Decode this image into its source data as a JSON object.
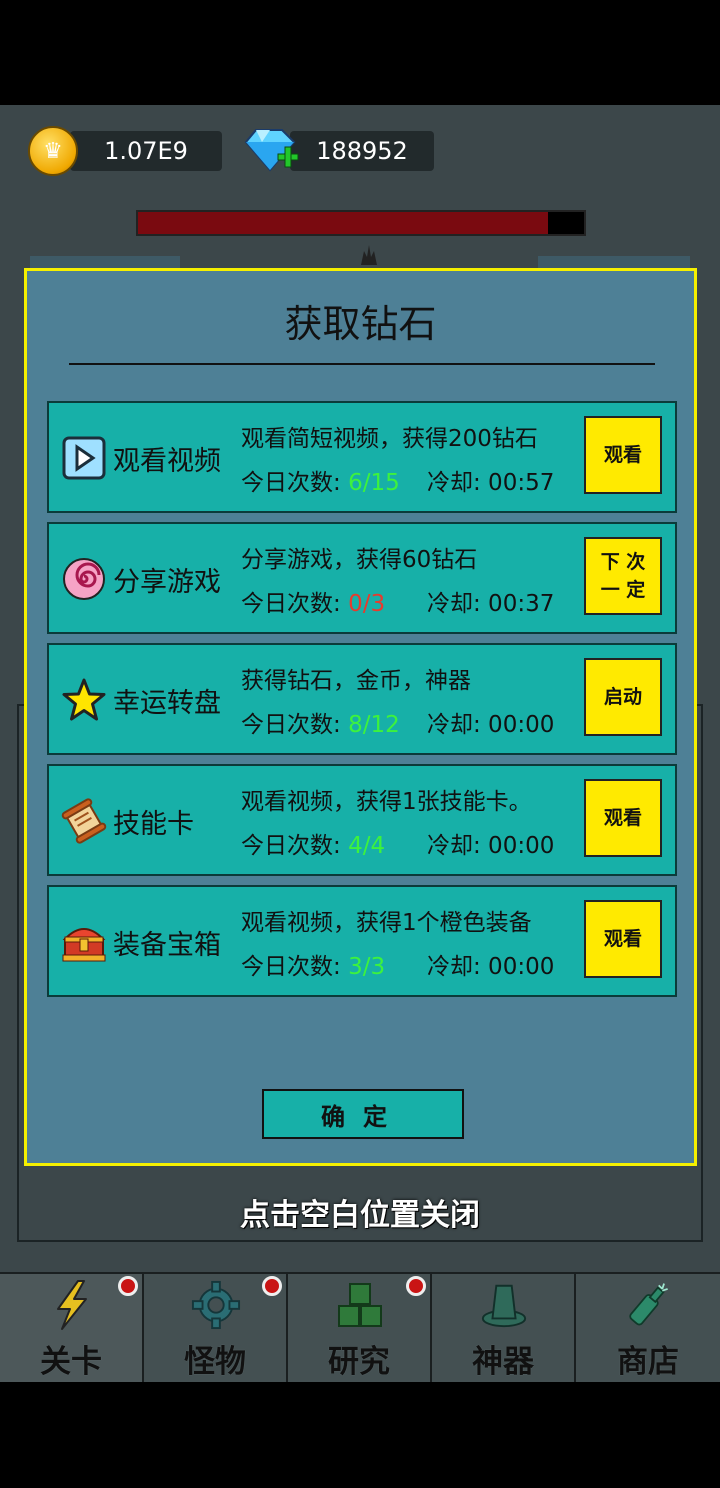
{
  "header": {
    "gold_amount": "1.07E9",
    "diamond_amount": "188952",
    "hp_fraction": 0.92
  },
  "modal": {
    "title": "获取钻石",
    "rows": [
      {
        "name": "观看视频",
        "desc": "观看简短视频，获得200钻石",
        "stat_label": "今日次数: ",
        "count": "6/15",
        "count_color": "#3df23d",
        "cooldown": "冷却: 00:57",
        "button": "观看",
        "icon": "play-icon"
      },
      {
        "name": "分享游戏",
        "desc": "分享游戏，获得60钻石",
        "stat_label": "今日次数: ",
        "count": "0/3",
        "count_color": "#e63b2e",
        "cooldown": "冷却: 00:37",
        "button_line1": "下 次",
        "button_line2": "一 定",
        "icon": "swirl-icon"
      },
      {
        "name": "幸运转盘",
        "desc": "获得钻石，金币，神器",
        "stat_label": "今日次数: ",
        "count": "8/12",
        "count_color": "#3df23d",
        "cooldown": "冷却: 00:00",
        "button": "启动",
        "icon": "star-icon"
      },
      {
        "name": "技能卡",
        "desc": "观看视频，获得1张技能卡。",
        "stat_label": "今日次数: ",
        "count": "4/4",
        "count_color": "#3df23d",
        "cooldown": "冷却: 00:00",
        "button": "观看",
        "icon": "scroll-icon"
      },
      {
        "name": "装备宝箱",
        "desc": "观看视频，获得1个橙色装备",
        "stat_label": "今日次数: ",
        "count": "3/3",
        "count_color": "#3df23d",
        "cooldown": "冷却: 00:00",
        "button": "观看",
        "icon": "treasure-chest-icon"
      }
    ],
    "confirm_label": "确定"
  },
  "hint": "点击空白位置关闭",
  "tabs": [
    {
      "label": "关卡",
      "icon": "lightning-icon",
      "badge": true
    },
    {
      "label": "怪物",
      "icon": "gear-icon",
      "badge": true
    },
    {
      "label": "研究",
      "icon": "blocks-icon",
      "badge": true
    },
    {
      "label": "神器",
      "icon": "hat-icon",
      "badge": false
    },
    {
      "label": "商店",
      "icon": "bottle-icon",
      "badge": false
    }
  ],
  "colors": {
    "accent_yellow": "#ffea00",
    "row_teal": "#17b0a8",
    "modal_bg": "#4e8096",
    "badge_red": "#c91414"
  }
}
